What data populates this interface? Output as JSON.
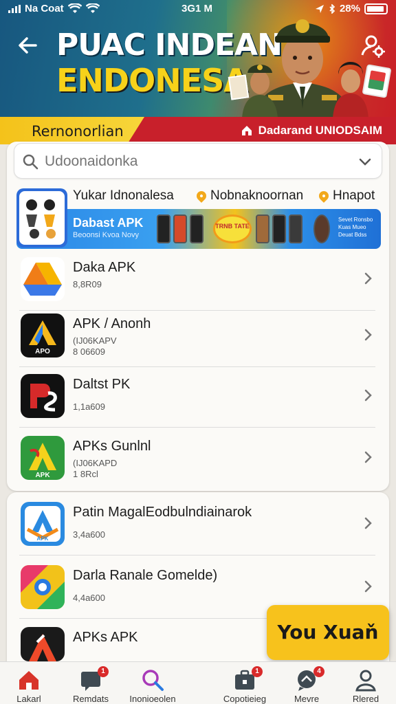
{
  "status_bar": {
    "carrier": "Na Coat",
    "time": "3G1 M",
    "battery": "28%"
  },
  "header": {
    "title_line1": "PUAC INDEAN",
    "title_line2": "ENDONESA"
  },
  "banner": {
    "tab_label": "Rernonorlian",
    "right_label": "Dadarand UNIODSAIM"
  },
  "search": {
    "placeholder": "Udoonaidonka"
  },
  "chips": {
    "main": "Yukar Idnonalesa",
    "items": [
      {
        "label": "Nobnaknoornan"
      },
      {
        "label": "Hnapot"
      }
    ]
  },
  "promo": {
    "title": "Dabast APK",
    "subtitle": "Beoonsi Kvoa Novy",
    "badge": "TRNB TATE",
    "right_text": "Sevet Ronsbo Kuas Mueo Deuat Bdss"
  },
  "apps": [
    {
      "title": "Daka APK",
      "meta1": "8,8R09",
      "meta2": ""
    },
    {
      "title": "APK / Anonh",
      "meta1": "(IJ06KAPV",
      "meta2": "8 06609"
    },
    {
      "title": "Daltst PK",
      "meta1": "1,1a609",
      "meta2": ""
    },
    {
      "title": "APKs Gunlnl",
      "meta1": "(IJ06KAPD",
      "meta2": "1 8Rcl"
    },
    {
      "title": "Patin MagalEodbulndiainarok",
      "meta1": "3,4a600",
      "meta2": ""
    },
    {
      "title": "Darla Ranale Gomelde)",
      "meta1": "4,4a600",
      "meta2": ""
    },
    {
      "title": "APKs APK",
      "meta1": "",
      "meta2": ""
    }
  ],
  "cta": {
    "label": "You Xuaň"
  },
  "bottom_nav": [
    {
      "label": "Lakarl",
      "icon": "home-icon",
      "badge": ""
    },
    {
      "label": "Remdats",
      "icon": "message-icon",
      "badge": "1"
    },
    {
      "label": "Inonioeolen",
      "icon": "search-icon",
      "badge": ""
    },
    {
      "label": "Copotieieg",
      "icon": "briefcase-icon",
      "badge": "1"
    },
    {
      "label": "Mevre",
      "icon": "chat-icon",
      "badge": "4"
    },
    {
      "label": "Rlered",
      "icon": "profile-icon",
      "badge": ""
    }
  ],
  "colors": {
    "accent_red": "#c8202b",
    "accent_yellow": "#f7c21c",
    "header_blue": "#17577f"
  }
}
